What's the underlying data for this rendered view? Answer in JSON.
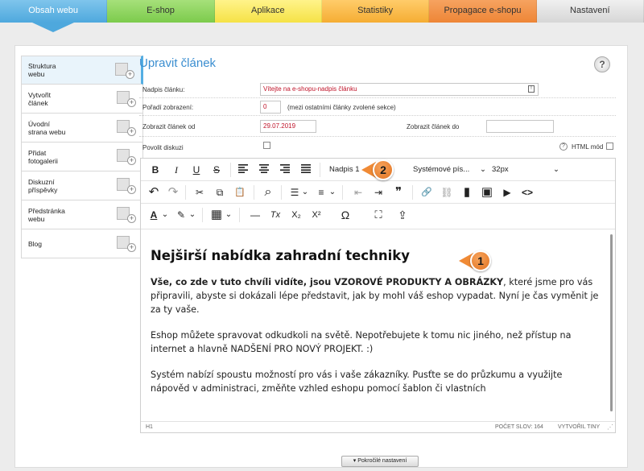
{
  "nav": {
    "tabs": [
      {
        "label": "Obsah webu"
      },
      {
        "label": "E-shop"
      },
      {
        "label": "Aplikace"
      },
      {
        "label": "Statistiky"
      },
      {
        "label": "Propagace e-shopu"
      },
      {
        "label": "Nastavení"
      }
    ],
    "active_index": 0
  },
  "sidebar": {
    "items": [
      {
        "label": "Struktura\nwebu",
        "icon": "sitemap-icon"
      },
      {
        "label": "Vytvořit\nčlánek",
        "icon": "add-article-icon"
      },
      {
        "label": "Úvodní\nstrana webu",
        "icon": "homepage-icon"
      },
      {
        "label": "Přidat\nfotogalerii",
        "icon": "gallery-icon"
      },
      {
        "label": "Diskuzní\npříspěvky",
        "icon": "comments-icon"
      },
      {
        "label": "Předstránka\nwebu",
        "icon": "prepage-icon"
      },
      {
        "label": "Blog",
        "icon": "blog-icon"
      }
    ]
  },
  "page": {
    "title": "Upravit článek",
    "help": "?"
  },
  "form": {
    "heading_label": "Nadpis článku:",
    "heading_value": "Vítejte na e-shopu-nadpis článku",
    "order_label": "Pořadí zobrazení:",
    "order_value": "0",
    "order_note": "(mezi ostatními články zvolené sekce)",
    "show_from_label": "Zobrazit článek od",
    "show_from_value": "29.07.2019",
    "show_to_label": "Zobrazit článek do",
    "show_to_value": "",
    "discussion_label": "Povolit diskuzi",
    "html_mode_label": "HTML mód"
  },
  "toolbar": {
    "bold": "B",
    "italic": "I",
    "underline": "U",
    "strike": "S",
    "format_select": "Nadpis 1",
    "font_select": "Systémové pís...",
    "size_select": "32px",
    "undo": "↶",
    "redo": "↷",
    "cut": "✂",
    "copy": "⧉",
    "paste": "📋",
    "find": "⌕",
    "bullets": "☰",
    "numbers": "≡",
    "outdent": "⇤",
    "indent": "⇥",
    "quote": "❞",
    "link": "🔗",
    "unlink": "⛓",
    "bookmark": "▮",
    "image": "▣",
    "media": "▶",
    "code": "<>",
    "text_color": "A",
    "highlight": "✎",
    "table": "▦",
    "hr": "—",
    "clear": "Tx",
    "subscript": "X₂",
    "superscript": "X²",
    "omega": "Ω",
    "fullscreen": "⛶",
    "upload": "⇪"
  },
  "content": {
    "heading": "Nejširší nabídka zahradní techniky",
    "p1_bold": "Vše, co zde v tuto chvíli vidíte, jsou VZOROVÉ PRODUKTY A OBRÁZKY",
    "p1_rest": ", které jsme pro vás připravili, abyste si dokázali lépe představit, jak by mohl váš eshop vypadat. Nyní je čas vyměnit je za ty vaše.",
    "p2": "Eshop můžete spravovat odkudkoli na světě. Nepotřebujete k tomu nic jiného, než přístup na internet a hlavně NADŠENÍ PRO NOVÝ PROJEKT. :)",
    "p3": "Systém nabízí spoustu možností pro vás i vaše zákazníky. Pusťte se do průzkumu a využijte nápověd v administraci, změňte vzhled eshopu pomocí šablon či vlastních"
  },
  "status": {
    "path": "H1",
    "wordcount": "POČET SLOV: 164",
    "powered": "VYTVOŘIL TINY"
  },
  "callouts": {
    "one": "1",
    "two": "2"
  },
  "footer": {
    "advanced_label": "Pokročilé nastavení"
  },
  "colors": {
    "accent": "#3b8ed0",
    "callout": "#f08a35",
    "date_red": "#c0142a"
  }
}
